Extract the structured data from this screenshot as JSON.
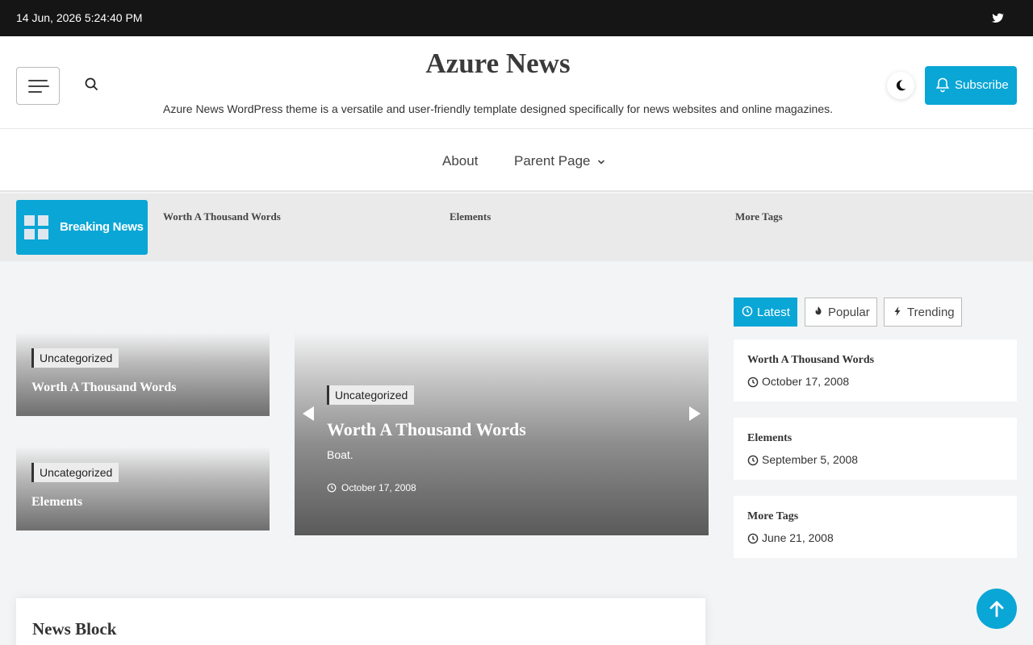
{
  "topbar": {
    "datetime": "14 Jun, 2026 5:24:40 PM",
    "social_icon": "twitter-icon"
  },
  "header": {
    "site_title": "Azure News",
    "site_description": "Azure News WordPress theme is a versatile and user-friendly template designed specifically for news websites and online magazines.",
    "subscribe_label": "Subscribe"
  },
  "nav": {
    "items": [
      {
        "label": "About"
      },
      {
        "label": "Parent Page"
      }
    ]
  },
  "breaking": {
    "label": "Breaking News",
    "items": [
      "Worth A Thousand Words",
      "Elements",
      "More Tags"
    ]
  },
  "featured": {
    "small": [
      {
        "category": "Uncategorized",
        "title": "Worth A Thousand Words"
      },
      {
        "category": "Uncategorized",
        "title": "Elements"
      }
    ],
    "main": {
      "category": "Uncategorized",
      "title": "Worth A Thousand Words",
      "excerpt": "Boat.",
      "date": "October 17, 2008"
    }
  },
  "sidebar": {
    "tabs": [
      {
        "label": "Latest"
      },
      {
        "label": "Popular"
      },
      {
        "label": "Trending"
      }
    ],
    "posts": [
      {
        "title": "Worth A Thousand Words",
        "date": "October 17, 2008"
      },
      {
        "title": "Elements",
        "date": "September 5, 2008"
      },
      {
        "title": "More Tags",
        "date": "June 21, 2008"
      }
    ]
  },
  "news_block": {
    "heading": "News Block"
  },
  "colors": {
    "accent": "#0aa6d6",
    "topbar": "#151515"
  }
}
